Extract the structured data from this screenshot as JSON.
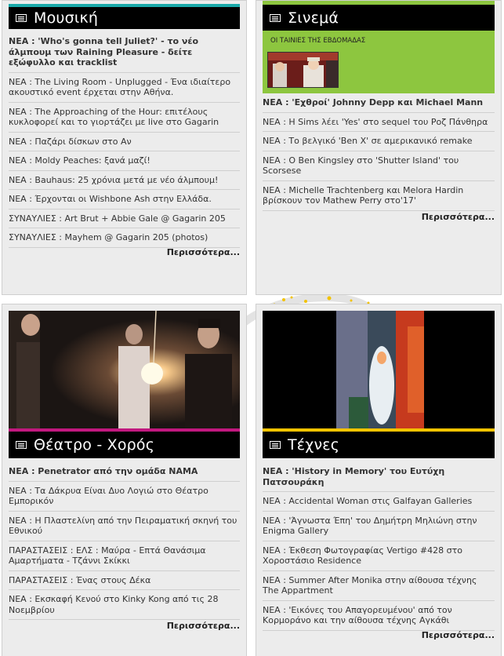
{
  "music": {
    "title": "Μουσική",
    "items": [
      "ΝΕΑ : 'Who's gonna tell Juliet?' - το νέο άλμπουμ των Raining Pleasure - δείτε εξώφυλλο και tracklist",
      "ΝΕΑ : The Living Room - Unplugged - Ένα ιδιαίτερο ακουστικό event έρχεται στην Αθήνα.",
      "ΝΕΑ : The Approaching of the Hour: επιτέλους κυκλοφορεί και το γιορτάζει με live στο Gagarin",
      "ΝΕΑ : Παζάρι δίσκων στο Αν",
      "ΝΕΑ : Moldy Peaches: ξανά μαζί!",
      "ΝΕΑ : Bauhaus: 25 χρόνια μετά με νέο άλμπουμ!",
      "ΝΕΑ : Έρχονται οι Wishbone Ash στην Ελλάδα.",
      "ΣΥΝΑΥΛΙΕΣ : Art Brut + Abbie Gale @ Gagarin 205",
      "ΣΥΝΑΥΛΙΕΣ : Mayhem @ Gagarin 205 (photos)"
    ],
    "more": "Περισσότερα..."
  },
  "cinema": {
    "title": "Σινεμά",
    "film_caption": "ΟΙ ΤΑΙΝΙΕΣ ΤΗΣ ΕΒΔΟΜΑΔΑΣ",
    "items": [
      "ΝΕΑ : 'Εχθροί' Johnny Depp και Michael Mann",
      "ΝΕΑ : Η Sims λέει 'Yes' στο sequel του Ροζ Πάνθηρα",
      "ΝΕΑ : Το βελγικό 'Ben X' σε αμερικανικό remake",
      "ΝΕΑ : Ο Ben Kingsley στο 'Shutter Island' του Scorsese",
      "ΝΕΑ : Michelle Trachtenberg και Melora Hardin βρίσκουν τον Mathew Perry στο'17'"
    ],
    "more": "Περισσότερα..."
  },
  "theatre": {
    "title": "Θέατρο - Χορός",
    "items": [
      "ΝΕΑ : Penetrator από την ομάδα ΝΑΜΑ",
      "ΝΕΑ : Τα Δάκρυα Είναι Δυο Λογιώ στο Θέατρο Εμπορικόν",
      "ΝΕΑ : Η Πλαστελίνη από την Πειραματική σκηνή του Εθνικού",
      "ΠΑΡΑΣΤΑΣΕΙΣ : ΕΛΣ : Μαύρα - Επτά Θανάσιμα Αμαρτήματα - Τζάννι Σκίκκι",
      "ΠΑΡΑΣΤΑΣΕΙΣ : Ένας στους Δέκα",
      "ΝΕΑ : Εκσκαφή Κενού στο Kinky Kong από τις 28 Νοεμβρίου"
    ],
    "more": "Περισσότερα..."
  },
  "arts": {
    "title": "Τέχνες",
    "items": [
      "ΝΕΑ : 'History in Memory' του Ευτύχη Πατσουράκη",
      "ΝΕΑ : Accidental Woman στις Galfayan Galleries",
      "ΝΕΑ : 'Άγνωστα Έπη' του Δημήτρη Μηλιώνη στην Enigma Gallery",
      "ΝΕΑ : Έκθεση Φωτογραφίας Vertigo #428 στο Χοροστάσιο Residence",
      "ΝΕΑ : Summer After Monika στην αίθουσα τέχνης The Appartment",
      "ΝΕΑ : 'Εικόνες του Απαγορευμένου' από τον Κορμοράνο και την αίθουσα τέχνης Αγκάθι"
    ],
    "more": "Περισσότερα..."
  },
  "colors": {
    "music_accent": "#1aa9a9",
    "cinema_accent": "#8dc63f",
    "theatre_accent": "#c2187f",
    "arts_accent": "#f5c400"
  }
}
